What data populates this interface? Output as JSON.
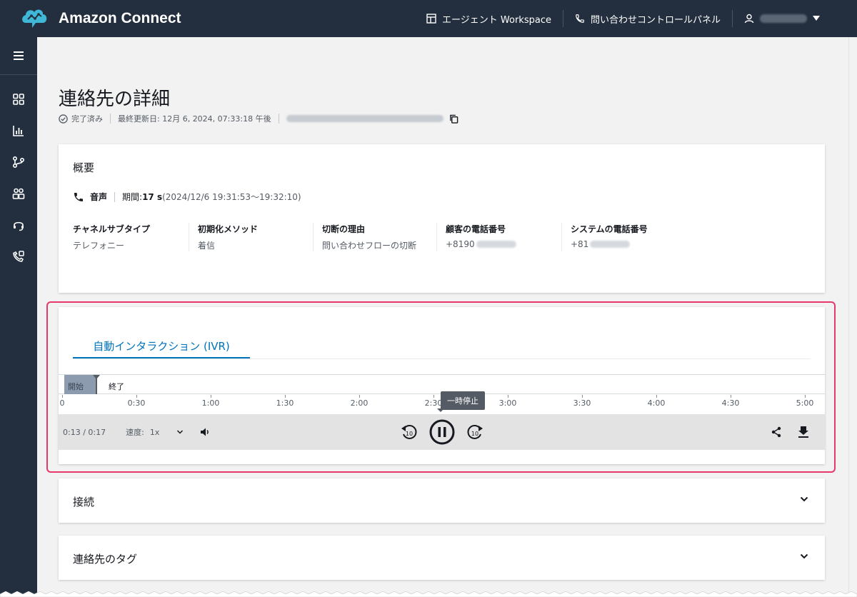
{
  "app": {
    "name": "Amazon Connect",
    "agent_workspace": "エージェント Workspace",
    "control_panel": "問い合わせコントロールパネル"
  },
  "page": {
    "title": "連絡先の詳細",
    "status": "完了済み",
    "last_updated": "最終更新日: 12月 6, 2024, 07:33:18 午後"
  },
  "overview": {
    "title": "概要",
    "channel": "音声",
    "duration_label": "期間: ",
    "duration_value": "17 s",
    "duration_range": " (2024/12/6 19:31:53〜19:32:10)",
    "fields": [
      {
        "label": "チャネルサブタイプ",
        "value": "テレフォニー"
      },
      {
        "label": "初期化メソッド",
        "value": "着信"
      },
      {
        "label": "切断の理由",
        "value": "問い合わせフローの切断"
      },
      {
        "label": "顧客の電話番号",
        "value": "+8190"
      },
      {
        "label": "システムの電話番号",
        "value": "+81"
      }
    ]
  },
  "ivr": {
    "tab_label": "自動インタラクション (IVR)",
    "segment_start": "開始",
    "segment_end": "終了",
    "ticks": [
      "0",
      "0:30",
      "1:00",
      "1:30",
      "2:00",
      "2:30",
      "3:00",
      "3:30",
      "4:00",
      "4:30",
      "5:00"
    ],
    "tooltip": "一時停止",
    "time": "0:13 / 0:17",
    "speed_label": "速度:",
    "speed_value": "1x",
    "progress_fraction": 0.765
  },
  "accordions": [
    {
      "title": "接続"
    },
    {
      "title": "連絡先のタグ"
    }
  ],
  "colors": {
    "nav_bg": "#232f3e",
    "accent": "#0073bb",
    "highlight_border": "#e6386b",
    "segment": "#8d9baf"
  }
}
